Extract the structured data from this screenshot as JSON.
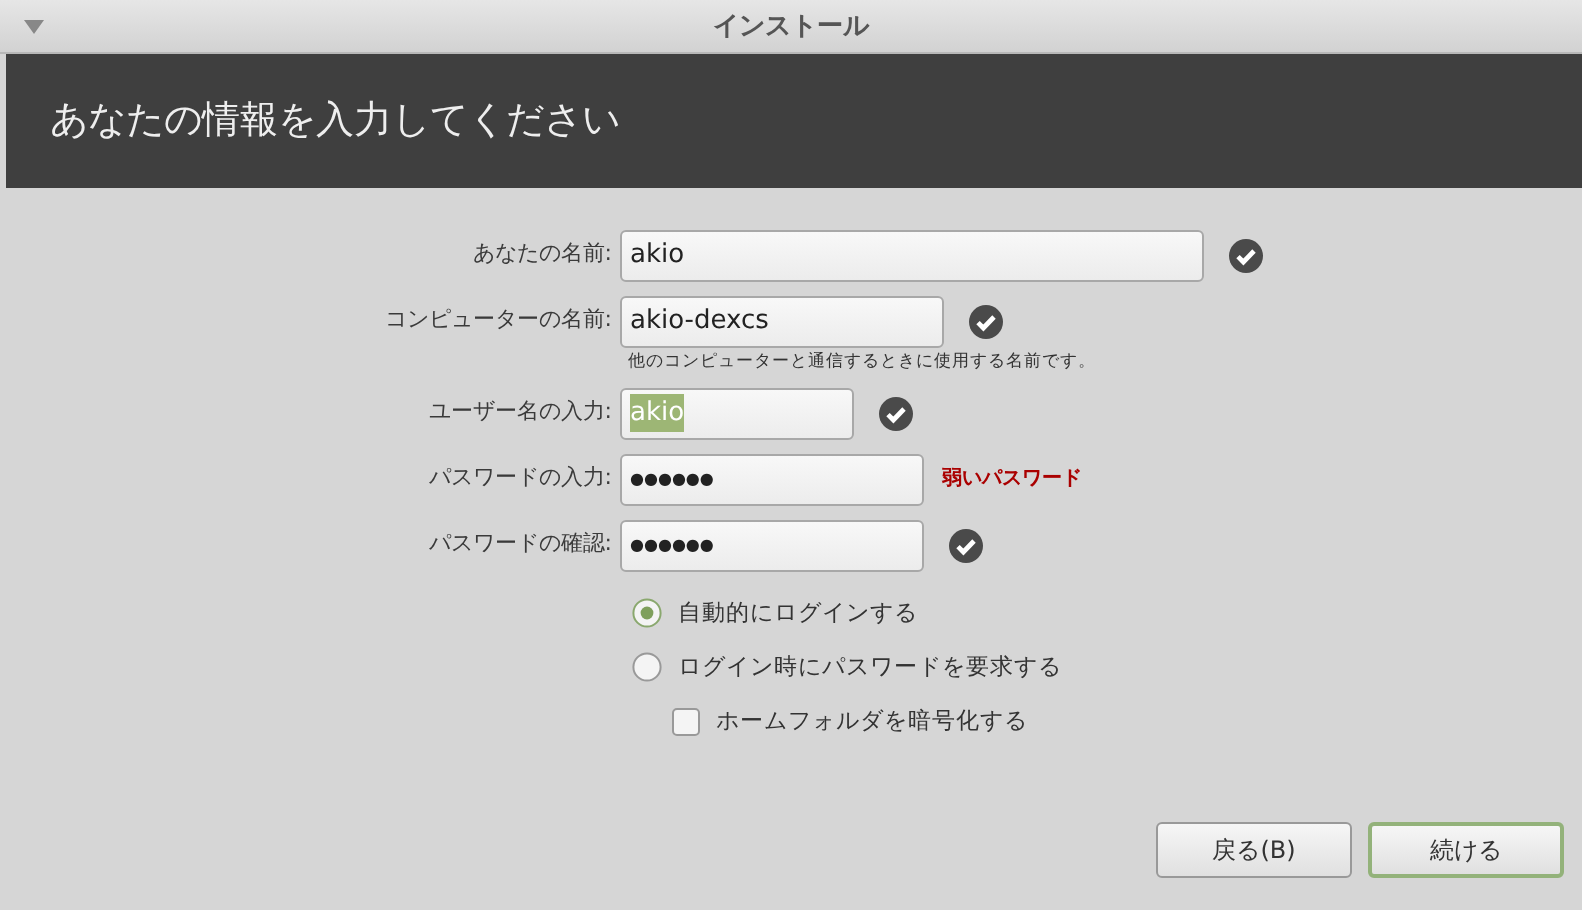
{
  "window": {
    "title": "インストール"
  },
  "header": "あなたの情報を入力してください",
  "fields": [
    {
      "label": "あなたの名前:",
      "value": "akio",
      "kind": "text",
      "highlighted": false,
      "valid": true
    },
    {
      "label": "コンピューターの名前:",
      "value": "akio-dexcs",
      "kind": "text",
      "highlighted": false,
      "valid": true,
      "hint": "他のコンピューターと通信するときに使用する名前です。"
    },
    {
      "label": "ユーザー名の入力:",
      "value": "akio",
      "kind": "text",
      "highlighted": true,
      "valid": true
    },
    {
      "label": "パスワードの入力:",
      "value": "●●●●●●",
      "kind": "password",
      "highlighted": false,
      "valid": false,
      "strength": "弱いパスワード"
    },
    {
      "label": "パスワードの確認:",
      "value": "●●●●●●",
      "kind": "password",
      "highlighted": false,
      "valid": true
    }
  ],
  "login_options": [
    {
      "label": "自動的にログインする",
      "kind": "radio",
      "selected": true
    },
    {
      "label": "ログイン時にパスワードを要求する",
      "kind": "radio",
      "selected": false
    },
    {
      "label": "ホームフォルダを暗号化する",
      "kind": "checkbox",
      "checked": false
    }
  ],
  "buttons": [
    {
      "label": "戻る(B)",
      "default": false
    },
    {
      "label": "続ける",
      "default": true
    }
  ]
}
